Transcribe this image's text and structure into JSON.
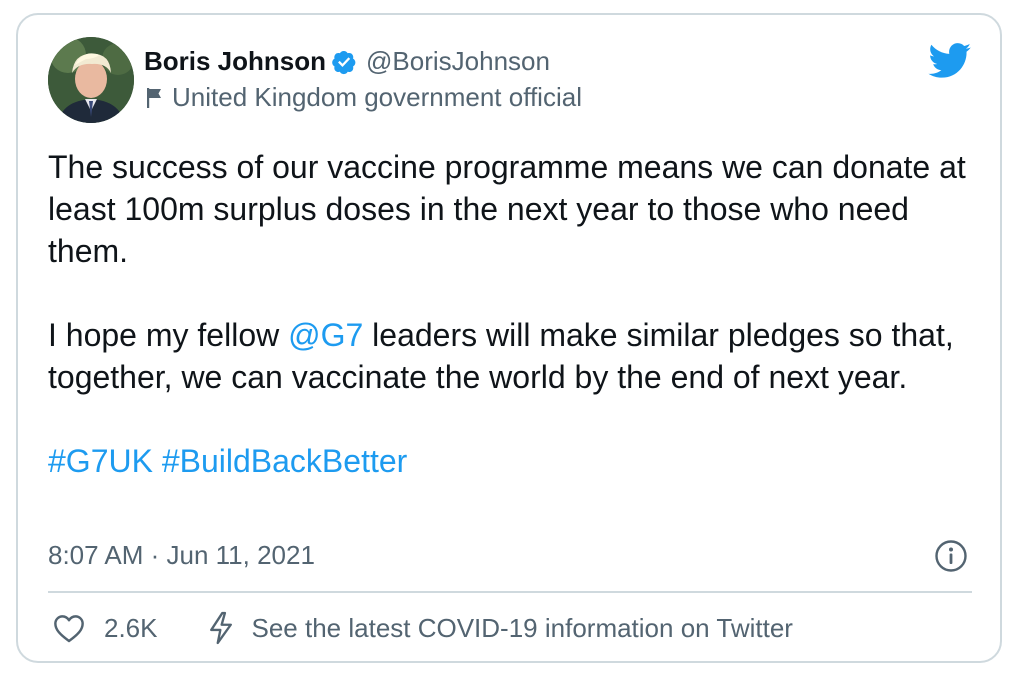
{
  "author": {
    "display_name": "Boris Johnson",
    "handle": "@BorisJohnson",
    "label": "United Kingdom government official",
    "verified_icon": "verified-badge-icon"
  },
  "tweet": {
    "paragraph1": "The success of our vaccine programme means we can donate at least 100m surplus doses in the next year to those who need them.",
    "paragraph2_before": "I hope my fellow ",
    "paragraph2_mention": "@G7",
    "paragraph2_after": " leaders will make similar pledges so that, together, we can vaccinate the world by the end of next year.",
    "hashtag1": "#G7UK",
    "hashtag_sep": " ",
    "hashtag2": "#BuildBackBetter"
  },
  "meta": {
    "timestamp": "8:07 AM · Jun 11, 2021"
  },
  "actions": {
    "like_count": "2.6K",
    "covid_info": "See the latest COVID-19 information on Twitter"
  },
  "colors": {
    "accent": "#1d9bf0",
    "secondary_text": "#536471",
    "border": "#cfd9de"
  }
}
